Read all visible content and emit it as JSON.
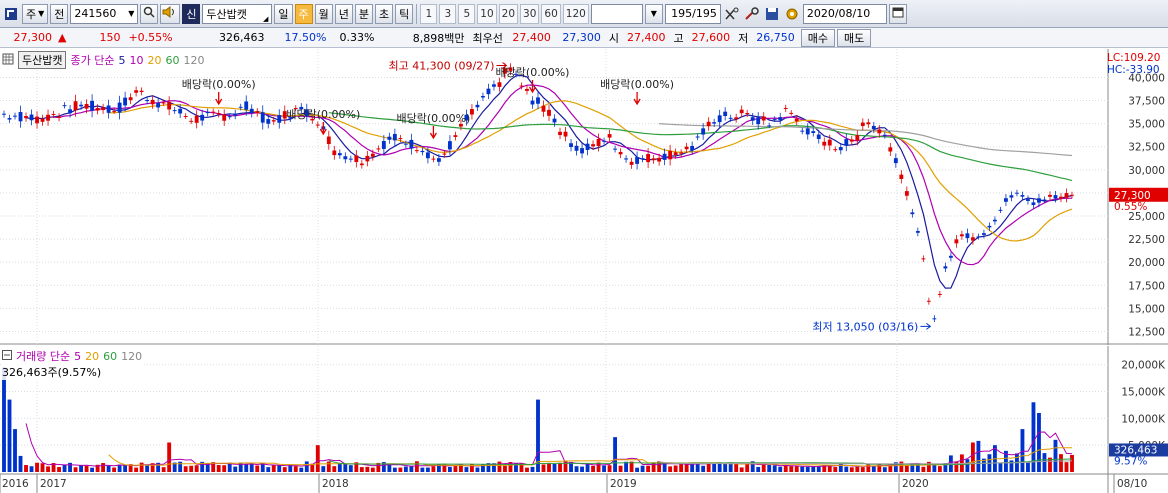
{
  "toolbar": {
    "market_label": "주",
    "prev_label": "전",
    "stock_code": "241560",
    "stock_badge": "신",
    "stock_name": "두산밥캣",
    "periods": [
      "일",
      "주",
      "월",
      "년",
      "분",
      "초",
      "틱"
    ],
    "active_period": "주",
    "intervals": [
      "1",
      "3",
      "5",
      "10",
      "20",
      "30",
      "60",
      "120"
    ],
    "view_count": "195",
    "view_total": "/195",
    "date": "2020/08/10"
  },
  "quote": {
    "price": "27,300",
    "change_arrow": "▲",
    "change": "150",
    "change_pct": "+0.55%",
    "volume": "326,463",
    "turnover_pct": "17.50%",
    "ratio_pct": "0.33%",
    "amount": "8,898백만",
    "best_label": "최우선",
    "best_ask": "27,400",
    "best_bid": "27,300",
    "open_label": "시",
    "open": "27,400",
    "high_label": "고",
    "high": "27,600",
    "low_label": "저",
    "low": "26,750",
    "buy_label": "매수",
    "sell_label": "매도"
  },
  "price_legend": {
    "name": "두산밥캣",
    "title": "종가 단순",
    "ma": [
      "5",
      "10",
      "20",
      "60",
      "120"
    ],
    "ma_colors": [
      "#1a1aa0",
      "#b000b0",
      "#e0a000",
      "#2e9e3e",
      "#a0a0a0"
    ]
  },
  "volume_legend": {
    "title": "거래량 단순",
    "ma": [
      "5",
      "20",
      "60",
      "120"
    ],
    "value_text": "326,463주(9.57%)"
  },
  "right_labels": {
    "lc": "LC:109.20",
    "hc": "HC:-33.90",
    "price": "27,300",
    "pct": "0.55%",
    "vol": "326,463",
    "vol_pct": "9.57%"
  },
  "annotations": {
    "high": "최고 41,300 (09/27)",
    "low": "최저 13,050 (03/16)",
    "dividend": "배당락(0.00%)"
  },
  "chart_data": {
    "type": "candlestick",
    "y_ticks": [
      "40,000",
      "37,500",
      "35,000",
      "32,500",
      "30,000",
      "27,500",
      "25,000",
      "22,500",
      "20,000",
      "17,500",
      "15,000",
      "12,500"
    ],
    "y_ticks_values": [
      40000,
      37500,
      35000,
      32500,
      30000,
      27500,
      25000,
      22500,
      20000,
      17500,
      15000,
      12500
    ],
    "ylim": [
      11250,
      42000
    ],
    "x_labels": [
      "2016",
      "2017",
      "2018",
      "2019",
      "2020",
      "08/10"
    ],
    "vol_ticks": [
      "20,000K",
      "15,000K",
      "10,000K",
      "5,000K"
    ],
    "vol_ticks_values": [
      20000,
      15000,
      10000,
      5000
    ],
    "vol_ylim": [
      0,
      22000
    ],
    "high": 41300,
    "low": 13050,
    "last": 27300
  }
}
